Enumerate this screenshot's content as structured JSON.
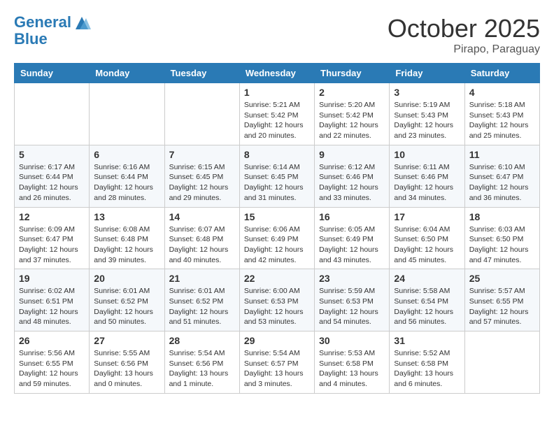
{
  "header": {
    "logo_line1": "General",
    "logo_line2": "Blue",
    "month": "October 2025",
    "location": "Pirapo, Paraguay"
  },
  "days_of_week": [
    "Sunday",
    "Monday",
    "Tuesday",
    "Wednesday",
    "Thursday",
    "Friday",
    "Saturday"
  ],
  "weeks": [
    [
      {
        "day": "",
        "info": ""
      },
      {
        "day": "",
        "info": ""
      },
      {
        "day": "",
        "info": ""
      },
      {
        "day": "1",
        "info": "Sunrise: 5:21 AM\nSunset: 5:42 PM\nDaylight: 12 hours\nand 20 minutes."
      },
      {
        "day": "2",
        "info": "Sunrise: 5:20 AM\nSunset: 5:42 PM\nDaylight: 12 hours\nand 22 minutes."
      },
      {
        "day": "3",
        "info": "Sunrise: 5:19 AM\nSunset: 5:43 PM\nDaylight: 12 hours\nand 23 minutes."
      },
      {
        "day": "4",
        "info": "Sunrise: 5:18 AM\nSunset: 5:43 PM\nDaylight: 12 hours\nand 25 minutes."
      }
    ],
    [
      {
        "day": "5",
        "info": "Sunrise: 6:17 AM\nSunset: 6:44 PM\nDaylight: 12 hours\nand 26 minutes."
      },
      {
        "day": "6",
        "info": "Sunrise: 6:16 AM\nSunset: 6:44 PM\nDaylight: 12 hours\nand 28 minutes."
      },
      {
        "day": "7",
        "info": "Sunrise: 6:15 AM\nSunset: 6:45 PM\nDaylight: 12 hours\nand 29 minutes."
      },
      {
        "day": "8",
        "info": "Sunrise: 6:14 AM\nSunset: 6:45 PM\nDaylight: 12 hours\nand 31 minutes."
      },
      {
        "day": "9",
        "info": "Sunrise: 6:12 AM\nSunset: 6:46 PM\nDaylight: 12 hours\nand 33 minutes."
      },
      {
        "day": "10",
        "info": "Sunrise: 6:11 AM\nSunset: 6:46 PM\nDaylight: 12 hours\nand 34 minutes."
      },
      {
        "day": "11",
        "info": "Sunrise: 6:10 AM\nSunset: 6:47 PM\nDaylight: 12 hours\nand 36 minutes."
      }
    ],
    [
      {
        "day": "12",
        "info": "Sunrise: 6:09 AM\nSunset: 6:47 PM\nDaylight: 12 hours\nand 37 minutes."
      },
      {
        "day": "13",
        "info": "Sunrise: 6:08 AM\nSunset: 6:48 PM\nDaylight: 12 hours\nand 39 minutes."
      },
      {
        "day": "14",
        "info": "Sunrise: 6:07 AM\nSunset: 6:48 PM\nDaylight: 12 hours\nand 40 minutes."
      },
      {
        "day": "15",
        "info": "Sunrise: 6:06 AM\nSunset: 6:49 PM\nDaylight: 12 hours\nand 42 minutes."
      },
      {
        "day": "16",
        "info": "Sunrise: 6:05 AM\nSunset: 6:49 PM\nDaylight: 12 hours\nand 43 minutes."
      },
      {
        "day": "17",
        "info": "Sunrise: 6:04 AM\nSunset: 6:50 PM\nDaylight: 12 hours\nand 45 minutes."
      },
      {
        "day": "18",
        "info": "Sunrise: 6:03 AM\nSunset: 6:50 PM\nDaylight: 12 hours\nand 47 minutes."
      }
    ],
    [
      {
        "day": "19",
        "info": "Sunrise: 6:02 AM\nSunset: 6:51 PM\nDaylight: 12 hours\nand 48 minutes."
      },
      {
        "day": "20",
        "info": "Sunrise: 6:01 AM\nSunset: 6:52 PM\nDaylight: 12 hours\nand 50 minutes."
      },
      {
        "day": "21",
        "info": "Sunrise: 6:01 AM\nSunset: 6:52 PM\nDaylight: 12 hours\nand 51 minutes."
      },
      {
        "day": "22",
        "info": "Sunrise: 6:00 AM\nSunset: 6:53 PM\nDaylight: 12 hours\nand 53 minutes."
      },
      {
        "day": "23",
        "info": "Sunrise: 5:59 AM\nSunset: 6:53 PM\nDaylight: 12 hours\nand 54 minutes."
      },
      {
        "day": "24",
        "info": "Sunrise: 5:58 AM\nSunset: 6:54 PM\nDaylight: 12 hours\nand 56 minutes."
      },
      {
        "day": "25",
        "info": "Sunrise: 5:57 AM\nSunset: 6:55 PM\nDaylight: 12 hours\nand 57 minutes."
      }
    ],
    [
      {
        "day": "26",
        "info": "Sunrise: 5:56 AM\nSunset: 6:55 PM\nDaylight: 12 hours\nand 59 minutes."
      },
      {
        "day": "27",
        "info": "Sunrise: 5:55 AM\nSunset: 6:56 PM\nDaylight: 13 hours\nand 0 minutes."
      },
      {
        "day": "28",
        "info": "Sunrise: 5:54 AM\nSunset: 6:56 PM\nDaylight: 13 hours\nand 1 minute."
      },
      {
        "day": "29",
        "info": "Sunrise: 5:54 AM\nSunset: 6:57 PM\nDaylight: 13 hours\nand 3 minutes."
      },
      {
        "day": "30",
        "info": "Sunrise: 5:53 AM\nSunset: 6:58 PM\nDaylight: 13 hours\nand 4 minutes."
      },
      {
        "day": "31",
        "info": "Sunrise: 5:52 AM\nSunset: 6:58 PM\nDaylight: 13 hours\nand 6 minutes."
      },
      {
        "day": "",
        "info": ""
      }
    ]
  ]
}
